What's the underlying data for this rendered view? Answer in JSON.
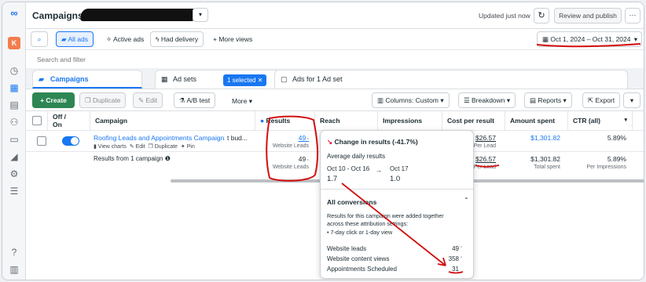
{
  "header": {
    "title": "Campaigns",
    "updated": "Updated just now",
    "review_publish": "Review and publish",
    "more": "···"
  },
  "rail": {
    "account_initial": "K"
  },
  "filters": {
    "search": "",
    "all_ads": "All ads",
    "active_ads": "Active ads",
    "had_delivery": "Had delivery",
    "more_views": "More views",
    "date_range": "Oct 1, 2024 – Oct 31, 2024",
    "search_placeholder": "Search and filter"
  },
  "tabs": {
    "campaigns": "Campaigns",
    "ad_sets": "Ad sets",
    "selected_chip": "1 selected",
    "chip_close": "✕",
    "ads_for": "Ads for 1 Ad set"
  },
  "toolbar": {
    "create": "+ Create",
    "duplicate": "Duplicate",
    "edit": "Edit",
    "ab_test": "A/B test",
    "more": "More",
    "columns": "Columns: Custom",
    "breakdown": "Breakdown",
    "reports": "Reports",
    "export": "Export"
  },
  "table": {
    "headers": {
      "off_on": "Off /",
      "off_on2": "On",
      "campaign": "Campaign",
      "results": "Results",
      "reach": "Reach",
      "impressions": "Impressions",
      "cost_per_result": "Cost per result",
      "amount_spent": "Amount spent",
      "ctr": "CTR (all)"
    },
    "row1": {
      "name": "Roofing Leads and Appointments Campaign",
      "view_charts": "View charts",
      "edit": "Edit",
      "duplicate": "Duplicate",
      "pin": "Pin",
      "truncated": "t bud...",
      "results": "49",
      "results_sub": "Website Leads",
      "cpr": "$26.57",
      "cpr_sub": "Per Lead",
      "spent": "$1,301.82",
      "ctr": "5.89%"
    },
    "row2": {
      "label": "Results from 1 campaign",
      "results": "49",
      "results_sub": "Website Leads",
      "cpr": "$26.57",
      "cpr_sub": "Per Lead",
      "spent": "$1,301.82",
      "spent_sub": "Total spent",
      "ctr": "5.89%",
      "ctr_sub": "Per Impressions"
    }
  },
  "popover": {
    "change_title": "Change in results (-41.7%)",
    "avg_label": "Average daily results",
    "range1": "Oct 10 - Oct 16",
    "arrow": "→",
    "range2": "Oct 17",
    "val1": "1.7",
    "val2": "1.0",
    "all_conv": "All conversions",
    "note_line1": "Results for this campaign were added together",
    "note_line2": "across these attribution settings:",
    "bullet": "• 7-day click or 1-day view",
    "rows": [
      {
        "label": "Website leads",
        "value": "49"
      },
      {
        "label": "Website content views",
        "value": "358"
      },
      {
        "label": "Appointments Scheduled",
        "value": "31"
      }
    ]
  },
  "colors": {
    "accent": "#1877f2",
    "create": "#2d8653",
    "annotation": "#d10f0f"
  }
}
